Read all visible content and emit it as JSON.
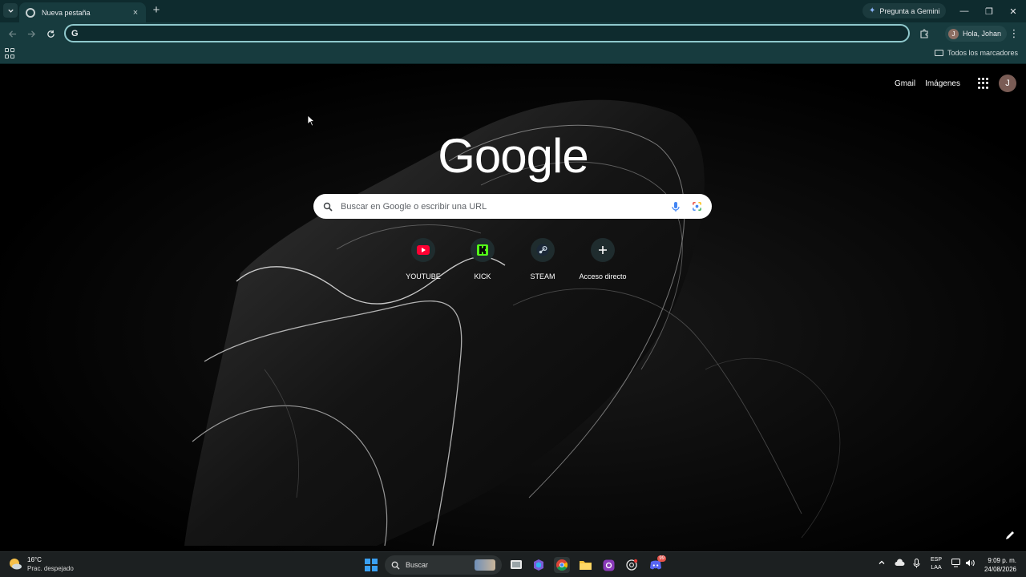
{
  "browser": {
    "tab": {
      "title": "Nueva pestaña",
      "close_glyph": "×"
    },
    "new_tab_glyph": "+",
    "gemini_label": "Pregunta a Gemini",
    "window_controls": {
      "minimize": "—",
      "restore": "❐",
      "close": "✕"
    },
    "omnibox": {
      "value": "",
      "g_glyph": "G"
    },
    "profile": {
      "initial": "J",
      "greeting": "Hola, Johan"
    },
    "menu_glyph": "⋮",
    "bookmarks": {
      "all_label": "Todos los marcadores"
    },
    "accent_color": "#0e2b2e"
  },
  "ntp": {
    "links": {
      "gmail": "Gmail",
      "images": "Imágenes"
    },
    "account_initial": "J",
    "logo_text": "Google",
    "search_placeholder": "Buscar en Google o escribir una URL",
    "shortcuts": [
      {
        "label": "YOUTUBE",
        "icon": "youtube-icon"
      },
      {
        "label": "KICK",
        "icon": "kick-icon"
      },
      {
        "label": "STEAM",
        "icon": "steam-icon"
      },
      {
        "label": "Acceso directo",
        "icon": "plus-icon"
      }
    ]
  },
  "taskbar": {
    "weather": {
      "temp": "16°C",
      "condition": "Prac. despejado"
    },
    "search_label": "Buscar",
    "ime": {
      "lang": "ESP",
      "layout": "LAA"
    },
    "time": "9:09 p. m.",
    "date": "24/08/2026",
    "discord_badge": "99"
  }
}
